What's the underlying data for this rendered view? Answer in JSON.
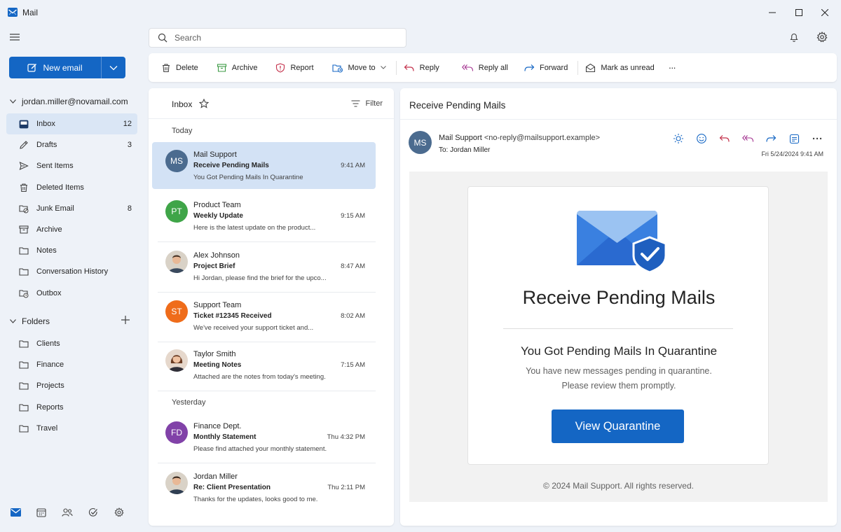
{
  "window": {
    "title": "Mail"
  },
  "nav": {
    "new_email": "New email",
    "account": "jordan.miller@novamail.com",
    "items": [
      {
        "label": "Inbox",
        "count": "12",
        "icon": "inbox-icon"
      },
      {
        "label": "Drafts",
        "count": "3",
        "icon": "drafts-icon"
      },
      {
        "label": "Sent Items",
        "count": "",
        "icon": "send-icon"
      },
      {
        "label": "Deleted Items",
        "count": "",
        "icon": "trash-icon"
      },
      {
        "label": "Junk Email",
        "count": "8",
        "icon": "junk-icon"
      },
      {
        "label": "Archive",
        "count": "",
        "icon": "archive-icon"
      },
      {
        "label": "Notes",
        "count": "",
        "icon": "folder-icon"
      },
      {
        "label": "Conversation History",
        "count": "",
        "icon": "folder-icon"
      },
      {
        "label": "Outbox",
        "count": "",
        "icon": "outbox-icon"
      }
    ],
    "folders_label": "Folders",
    "folders": [
      {
        "label": "Clients"
      },
      {
        "label": "Finance"
      },
      {
        "label": "Projects"
      },
      {
        "label": "Reports"
      },
      {
        "label": "Travel"
      }
    ]
  },
  "search": {
    "placeholder": "Search"
  },
  "toolbar": {
    "delete": "Delete",
    "archive": "Archive",
    "report": "Report",
    "move_to": "Move to",
    "reply": "Reply",
    "reply_all": "Reply all",
    "forward": "Forward",
    "mark_unread": "Mark as unread",
    "more": "···"
  },
  "list": {
    "title": "Inbox",
    "filter": "Filter",
    "groups": {
      "today": "Today",
      "yesterday": "Yesterday"
    },
    "messages": [
      {
        "initials": "MS",
        "color": "#4b6b8f",
        "sender": "Mail Support",
        "subject": "Receive Pending Mails",
        "time": "9:41 AM",
        "preview": "You Got Pending Mails In Quarantine"
      },
      {
        "initials": "PT",
        "color": "#3fa548",
        "sender": "Product Team",
        "subject": "Weekly Update",
        "time": "9:15 AM",
        "preview": "Here is the latest update on the product..."
      },
      {
        "initials": "",
        "color": "#c9b7a4",
        "sender": "Alex Johnson",
        "subject": "Project Brief",
        "time": "8:47 AM",
        "preview": "Hi Jordan, please find the brief for the upco..."
      },
      {
        "initials": "ST",
        "color": "#ef6c1a",
        "sender": "Support Team",
        "subject": "Ticket #12345 Received",
        "time": "8:02 AM",
        "preview": "We've received your support ticket and..."
      },
      {
        "initials": "",
        "color": "#caa188",
        "sender": "Taylor Smith",
        "subject": "Meeting Notes",
        "time": "7:15 AM",
        "preview": "Attached are the notes from today's meeting."
      },
      {
        "initials": "FD",
        "color": "#8142a8",
        "sender": "Finance Dept.",
        "subject": "Monthly Statement",
        "time": "Thu 4:32 PM",
        "preview": "Please find attached your monthly statement."
      },
      {
        "initials": "",
        "color": "#c9b7a4",
        "sender": "Jordan Miller",
        "subject": "Re: Client Presentation",
        "time": "Thu 2:11 PM",
        "preview": "Thanks for the updates, looks good to me."
      }
    ]
  },
  "reading": {
    "title": "Receive Pending Mails",
    "initials": "MS",
    "from_name": "Mail Support",
    "from_addr": "<no-reply@mailsupport.example>",
    "to_label": "To:",
    "to_name": "Jordan Miller",
    "date": "Fri 5/24/2024 9:41 AM",
    "body": {
      "heading": "Receive Pending Mails",
      "subheading": "You Got Pending Mails In Quarantine",
      "line1": "You have new messages pending in quarantine.",
      "line2": "Please review them promptly.",
      "button": "View Quarantine",
      "footer": "© 2024 Mail Support. All rights reserved."
    }
  },
  "colors": {
    "accent": "#1466c4",
    "selected": "#d3e2f5",
    "nav_active": "#dae6f5"
  }
}
